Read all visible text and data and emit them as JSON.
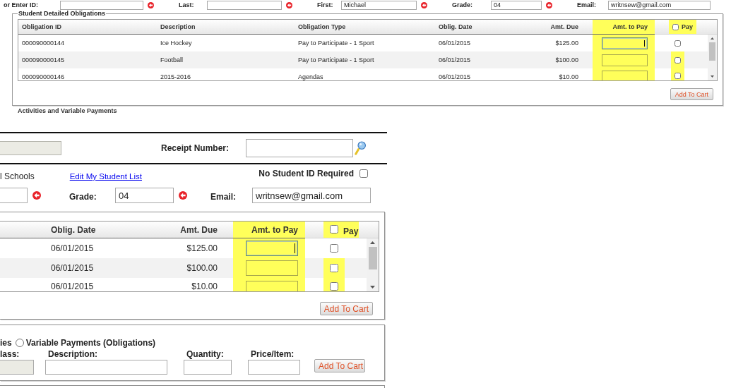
{
  "overview": {
    "fields": [
      {
        "label": "or Enter ID:",
        "flagged": true
      },
      {
        "label": "Last:",
        "flagged": true
      },
      {
        "label": "First:",
        "value": "Michael",
        "flagged": true
      },
      {
        "label": "Grade:",
        "value": "04",
        "flagged": true
      },
      {
        "label": "Email:",
        "value": "writnsew@gmail.com",
        "flagged": false
      }
    ],
    "obligations": {
      "legend": "Student Detailed Obligations",
      "columns": [
        {
          "label": "Obligation ID",
          "kind": "text",
          "highlighted": false
        },
        {
          "label": "Description",
          "kind": "text",
          "highlighted": false
        },
        {
          "label": "Obligation Type",
          "kind": "text",
          "highlighted": false
        },
        {
          "label": "Oblig. Date",
          "kind": "text",
          "highlighted": false
        },
        {
          "label": "Amt. Due",
          "kind": "amount",
          "highlighted": false
        },
        {
          "label": "Amt. to Pay",
          "kind": "input",
          "highlighted": true
        },
        {
          "label": "Pay",
          "kind": "checkbox",
          "highlighted": true,
          "checked": false
        }
      ],
      "rows": [
        {
          "cells": [
            "000090000144",
            "Ice Hockey",
            "Pay to Participate - 1 Sport",
            "06/01/2015",
            "$125.00"
          ],
          "focused": true,
          "pay_checked": false,
          "pay_highlighted": false
        },
        {
          "cells": [
            "000090000145",
            "Football",
            "Pay to Participate - 1 Sport",
            "06/01/2015",
            "$100.00"
          ],
          "focused": false,
          "pay_checked": false,
          "pay_highlighted": true
        },
        {
          "cells": [
            "000090000146",
            "2015-2016",
            "Agendas",
            "06/01/2015",
            "$10.00"
          ],
          "focused": false,
          "pay_checked": false,
          "pay_highlighted": true
        }
      ],
      "button": "Add To Cart"
    },
    "next_section": "Activities and Variable Payments"
  },
  "zoomed_view": {
    "lookup_field": {
      "disabled": true
    },
    "receipt_label": "Receipt Number:",
    "school_fragment": "l Schools",
    "edit_link": "Edit My Student List",
    "no_id": {
      "label": "No Student ID Required",
      "checked": false
    },
    "fields": [
      {
        "flagged": true
      },
      {
        "label": "Grade:",
        "value": "04",
        "flagged": true
      },
      {
        "label": "Email:",
        "value": "writnsew@gmail.com",
        "flagged": false
      }
    ],
    "obligations": {
      "columns": [
        {
          "label": "Oblig. Date",
          "kind": "text",
          "highlighted": false
        },
        {
          "label": "Amt. Due",
          "kind": "amount",
          "highlighted": false
        },
        {
          "label": "Amt. to Pay",
          "kind": "input",
          "highlighted": true
        },
        {
          "label": "Pay",
          "kind": "checkbox",
          "highlighted": true,
          "checked": false
        }
      ],
      "rows": [
        {
          "cells": [
            "06/01/2015",
            "$125.00"
          ],
          "focused": true,
          "pay_checked": false,
          "pay_highlighted": false
        },
        {
          "cells": [
            "06/01/2015",
            "$100.00"
          ],
          "focused": false,
          "pay_checked": false,
          "pay_highlighted": true
        },
        {
          "cells": [
            "06/01/2015",
            "$10.00"
          ],
          "focused": false,
          "pay_checked": false,
          "pay_highlighted": true
        }
      ],
      "button": "Add To Cart"
    },
    "activities": {
      "fragment": "ies",
      "option": {
        "label": "Variable Payments (Obligations)",
        "selected": false
      },
      "fields": [
        {
          "label": "lass:",
          "disabled": true
        },
        {
          "label": "Description:",
          "disabled": false
        },
        {
          "label": "Quantity:",
          "disabled": false
        },
        {
          "label": "Price/Item:",
          "disabled": false
        }
      ],
      "button": "Add To Cart"
    }
  }
}
